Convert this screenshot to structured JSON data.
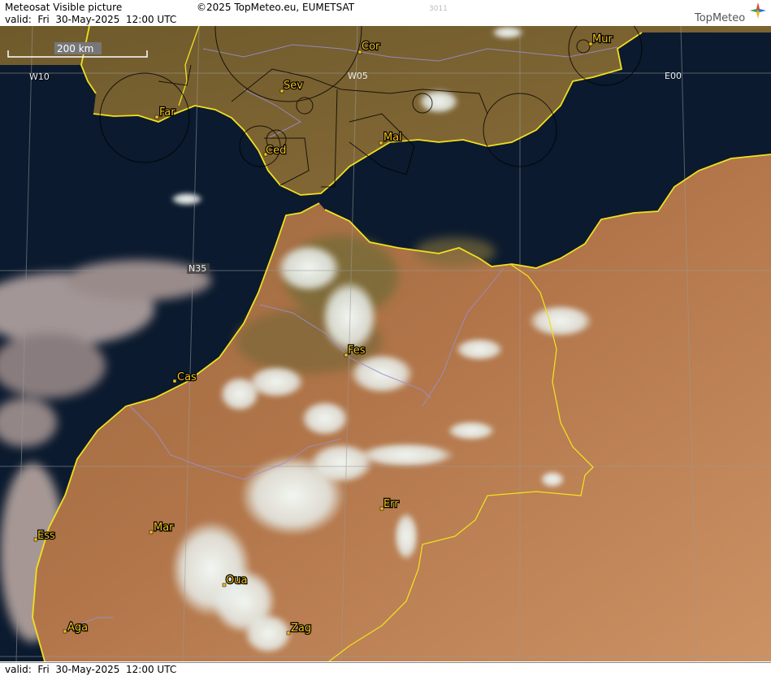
{
  "header": {
    "title": "Meteosat Visible picture",
    "copyright": "©2025 TopMeteo.eu, EUMETSAT",
    "valid_label": "valid:  Fri  30-May-2025  12:00 UTC",
    "image_code": "3011",
    "brand": "TopMeteo"
  },
  "footer": {
    "valid_label": "valid:  Fri  30-May-2025  12:00 UTC"
  },
  "map": {
    "scale_label": "200 km",
    "grid_labels": [
      "W10",
      "W05",
      "E00",
      "N35"
    ],
    "cities": [
      "Cor",
      "Mur",
      "Sev",
      "Far",
      "Ced",
      "Mal",
      "Fes",
      "Cas",
      "Err",
      "Ess",
      "Mar",
      "Oua",
      "Aga",
      "Zag"
    ],
    "colors": {
      "sea": "#0b1a2e",
      "land_north": "#7a6230",
      "land_south": "#b4764a",
      "desert": "#c98d5e",
      "cloud": "#e6ece8",
      "coastline": "#f0e020",
      "city_label": "#f2c21a",
      "border": "#000000",
      "river": "#9a8fd0"
    }
  }
}
